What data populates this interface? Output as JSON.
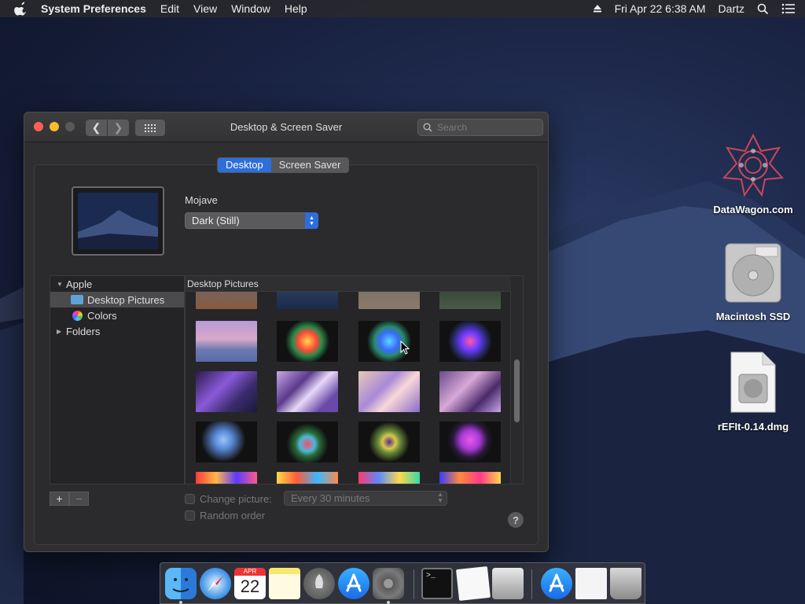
{
  "menubar": {
    "app_name": "System Preferences",
    "items": [
      "Edit",
      "View",
      "Window",
      "Help"
    ],
    "datetime": "Fri Apr 22  6:38 AM",
    "user": "Dartz"
  },
  "window": {
    "title": "Desktop & Screen Saver",
    "search_placeholder": "Search",
    "tabs": [
      {
        "label": "Desktop",
        "active": true
      },
      {
        "label": "Screen Saver",
        "active": false
      }
    ],
    "wallpaper_name": "Mojave",
    "wallpaper_style": "Dark (Still)",
    "source_list": [
      {
        "label": "Apple",
        "level": 0,
        "expanded": true
      },
      {
        "label": "Desktop Pictures",
        "level": 1,
        "selected": true,
        "icon": "folder-icon"
      },
      {
        "label": "Colors",
        "level": 1,
        "icon": "colors-icon"
      },
      {
        "label": "Folders",
        "level": 0,
        "expanded": false
      }
    ],
    "grid_header": "Desktop Pictures",
    "add_label": "+",
    "remove_label": "−",
    "change_picture_label": "Change picture:",
    "change_interval": "Every 30 minutes",
    "random_order_label": "Random order",
    "help_label": "?"
  },
  "desktop_icons": [
    {
      "label": "DataWagon.com",
      "icon": "datawagon-logo-icon"
    },
    {
      "label": "Macintosh SSD",
      "icon": "hard-drive-icon"
    },
    {
      "label": "rEFIt-0.14.dmg",
      "icon": "disk-image-icon"
    }
  ],
  "dock": {
    "items": [
      "finder-icon",
      "safari-icon",
      "calendar-icon",
      "notes-icon",
      "launchpad-icon",
      "app-store-icon",
      "system-preferences-icon",
      "terminal-icon",
      "textedit-icon",
      "disk-utility-icon",
      "app-store-download-icon",
      "document-icon",
      "trash-icon"
    ],
    "calendar_month": "APR",
    "calendar_day": "22",
    "terminal_prompt": ">_"
  },
  "colors": {
    "accent": "#2d6ed9",
    "close": "#fc5f57",
    "minimize": "#fdbc2e"
  }
}
